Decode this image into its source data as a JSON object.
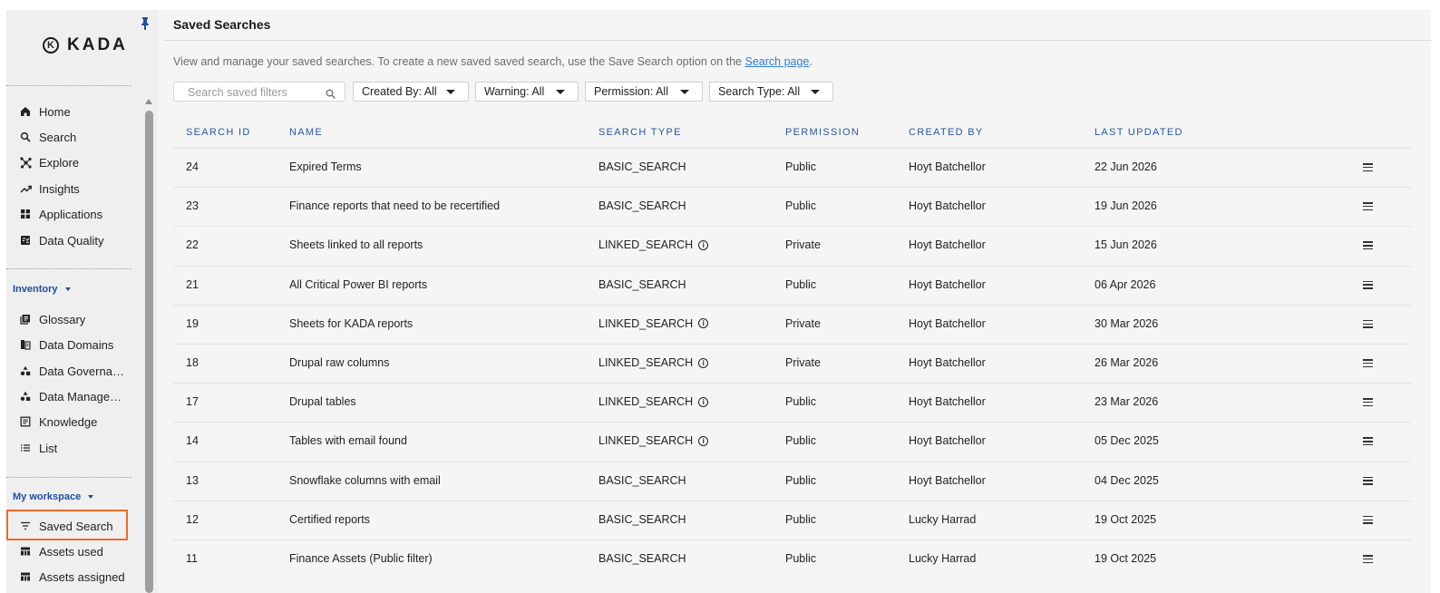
{
  "sidebar": {
    "logo_text": "KADA",
    "logo_mark": "K",
    "nav": [
      {
        "label": "Home",
        "icon": "home-icon"
      },
      {
        "label": "Search",
        "icon": "search-icon"
      },
      {
        "label": "Explore",
        "icon": "explore-icon"
      },
      {
        "label": "Insights",
        "icon": "trending-up-icon"
      },
      {
        "label": "Applications",
        "icon": "grid-icon"
      },
      {
        "label": "Data Quality",
        "icon": "quality-icon"
      }
    ],
    "inventory_header": "Inventory",
    "inventory": [
      {
        "label": "Glossary",
        "icon": "glossary-icon"
      },
      {
        "label": "Data Domains",
        "icon": "domains-icon"
      },
      {
        "label": "Data Governance",
        "icon": "shapes-icon"
      },
      {
        "label": "Data Management",
        "icon": "shapes-icon"
      },
      {
        "label": "Knowledge",
        "icon": "article-icon"
      },
      {
        "label": "List",
        "icon": "list-icon"
      }
    ],
    "workspace_header": "My workspace",
    "workspace": [
      {
        "label": "Saved Search",
        "icon": "filter-icon",
        "active": true
      },
      {
        "label": "Assets used",
        "icon": "table-icon"
      },
      {
        "label": "Assets assigned",
        "icon": "table-icon"
      }
    ]
  },
  "header": {
    "title": "Saved Searches",
    "description": "View and manage your saved searches. To create a new saved saved search, use the Save Search option on the ",
    "description_link": "Search page",
    "description_end": "."
  },
  "filters": {
    "search_placeholder": "Search saved filters",
    "created_by": "Created By: All",
    "warning": "Warning: All",
    "permission": "Permission: All",
    "search_type": "Search Type: All"
  },
  "table": {
    "columns": [
      "SEARCH ID",
      "NAME",
      "SEARCH TYPE",
      "PERMISSION",
      "CREATED BY",
      "LAST UPDATED"
    ],
    "rows": [
      {
        "id": "24",
        "name": "Expired Terms",
        "type": "BASIC_SEARCH",
        "info": false,
        "permission": "Public",
        "created_by": "Hoyt Batchellor",
        "updated": "22 Jun 2026"
      },
      {
        "id": "23",
        "name": "Finance reports that need to be recertified",
        "type": "BASIC_SEARCH",
        "info": false,
        "permission": "Public",
        "created_by": "Hoyt Batchellor",
        "updated": "19 Jun 2026"
      },
      {
        "id": "22",
        "name": "Sheets linked to all reports",
        "type": "LINKED_SEARCH",
        "info": true,
        "permission": "Private",
        "created_by": "Hoyt Batchellor",
        "updated": "15 Jun 2026"
      },
      {
        "id": "21",
        "name": "All Critical Power BI reports",
        "type": "BASIC_SEARCH",
        "info": false,
        "permission": "Public",
        "created_by": "Hoyt Batchellor",
        "updated": "06 Apr 2026"
      },
      {
        "id": "19",
        "name": "Sheets for KADA reports",
        "type": "LINKED_SEARCH",
        "info": true,
        "permission": "Private",
        "created_by": "Hoyt Batchellor",
        "updated": "30 Mar 2026"
      },
      {
        "id": "18",
        "name": "Drupal raw columns",
        "type": "LINKED_SEARCH",
        "info": true,
        "permission": "Private",
        "created_by": "Hoyt Batchellor",
        "updated": "26 Mar 2026"
      },
      {
        "id": "17",
        "name": "Drupal tables",
        "type": "LINKED_SEARCH",
        "info": true,
        "permission": "Public",
        "created_by": "Hoyt Batchellor",
        "updated": "23 Mar 2026"
      },
      {
        "id": "14",
        "name": "Tables with email found",
        "type": "LINKED_SEARCH",
        "info": true,
        "permission": "Public",
        "created_by": "Hoyt Batchellor",
        "updated": "05 Dec 2025"
      },
      {
        "id": "13",
        "name": "Snowflake columns with email",
        "type": "BASIC_SEARCH",
        "info": false,
        "permission": "Public",
        "created_by": "Hoyt Batchellor",
        "updated": "04 Dec 2025"
      },
      {
        "id": "12",
        "name": "Certified reports",
        "type": "BASIC_SEARCH",
        "info": false,
        "permission": "Public",
        "created_by": "Lucky Harrad",
        "updated": "19 Oct 2025"
      },
      {
        "id": "11",
        "name": "Finance Assets (Public filter)",
        "type": "BASIC_SEARCH",
        "info": false,
        "permission": "Public",
        "created_by": "Lucky Harrad",
        "updated": "19 Oct 2025"
      }
    ],
    "info_glyph": "i"
  },
  "colors": {
    "accent": "#2457a6",
    "link": "#2f7fd3",
    "highlight": "#ee6a2b"
  }
}
